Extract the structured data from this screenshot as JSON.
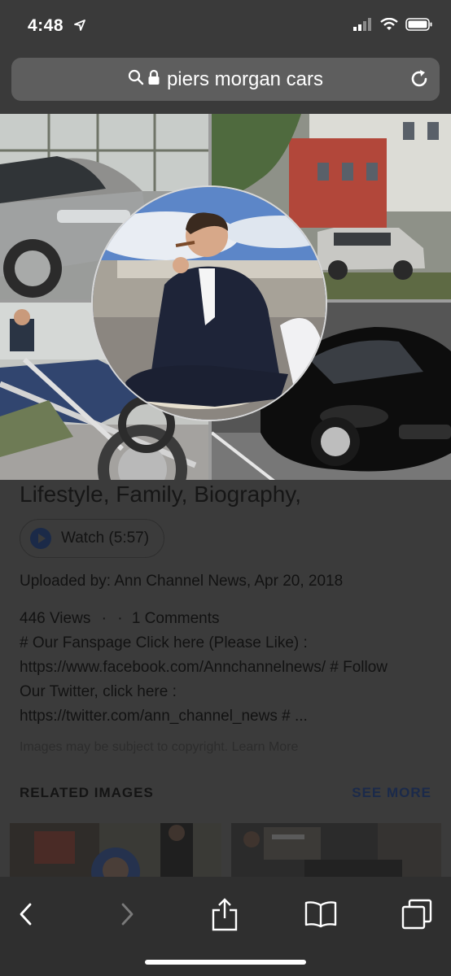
{
  "status": {
    "time": "4:48"
  },
  "browser": {
    "url_text": "piers morgan cars"
  },
  "article": {
    "title": "Lifestyle, Family, Biography,",
    "watch_label": "Watch (5:57)",
    "uploaded": "Uploaded by: Ann Channel News, Apr 20, 2018",
    "views": "446 Views",
    "comments": "1 Comments",
    "desc_lines": [
      "# Our Fanspage Click here (Please Like) :",
      "https://www.facebook.com/Annchannelnews/ # Follow",
      "Our Twitter, click here :",
      "https://twitter.com/ann_channel_news # ..."
    ],
    "copyright": "Images may be subject to copyright. Learn More"
  },
  "related": {
    "heading": "RELATED IMAGES",
    "see_more": "SEE MORE"
  },
  "colors": {
    "link": "#1b2a4a",
    "toolbar_bg": "#2f2f2f",
    "url_bar_bg": "#5e5e5e"
  },
  "icons": {
    "location": "location-arrow-icon",
    "search": "search-icon",
    "lock": "lock-icon",
    "reload": "reload-icon",
    "back": "back-chevron-icon",
    "forward": "forward-chevron-icon",
    "share": "share-icon",
    "bookmarks": "book-icon",
    "tabs": "tabs-icon"
  }
}
